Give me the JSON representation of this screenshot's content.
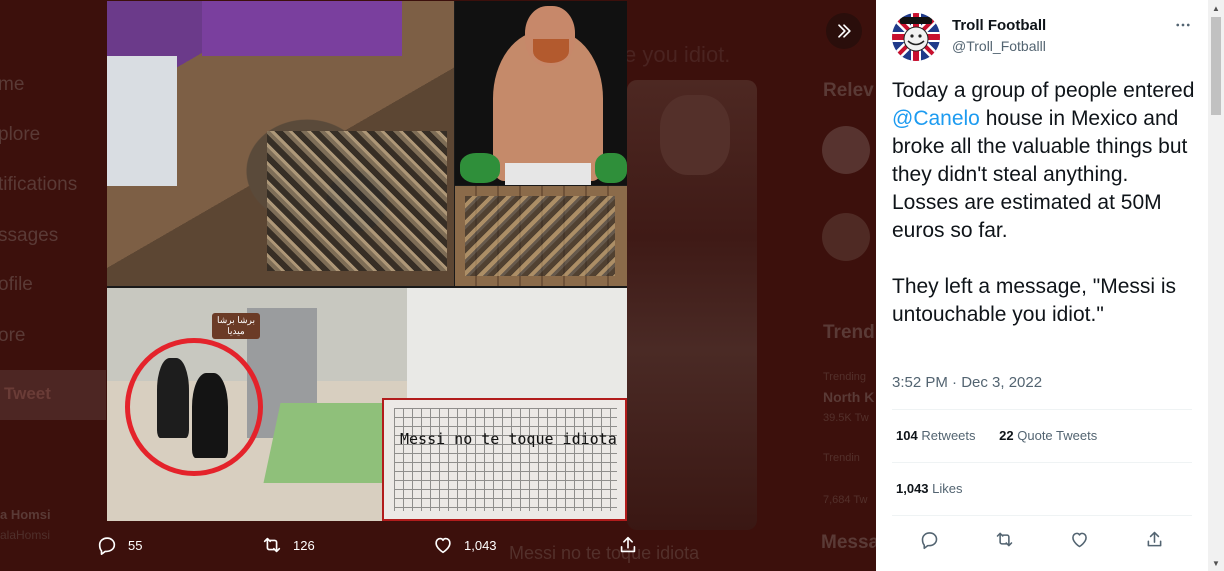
{
  "background": {
    "nav_items": [
      "me",
      "plore",
      "tifications",
      "ssages",
      "ofile",
      "ore"
    ],
    "tweet_button": "Tweet",
    "account_name": "a Homsi",
    "account_handle": "alaHomsi",
    "caption_top": "e you idiot.",
    "caption_bottom": "Messi no te toque idiota",
    "relevant_header": "Relev",
    "trends_header": "Trend",
    "trend_small_1": "Trending",
    "trend_name": "North K",
    "trend_count": "39.5K Tw",
    "trend_small_2": "Trendin",
    "trend_count_2": "7,684 Tw",
    "messages_header": "Messa"
  },
  "media": {
    "badge_line1": "برشا برشا",
    "badge_line2": "ميديا",
    "note_text": "Messi no te toque idiota"
  },
  "media_actions": {
    "replies": "55",
    "retweets": "126",
    "likes": "1,043"
  },
  "tweet": {
    "author_name": "Troll Football",
    "author_handle": "@Troll_Fotballl",
    "text_before": "Today a group of people entered ",
    "mention": "@Canelo",
    "text_after": " house in Mexico and broke all the valuable things but they didn't steal anything. Losses are estimated at 50M euros so far.\n\nThey left a message, \"Messi is untouchable you idiot.\"",
    "timestamp": "3:52 PM · Dec 3, 2022",
    "retweets_count": "104",
    "retweets_label": "Retweets",
    "quote_count": "22",
    "quote_label": "Quote Tweets",
    "likes_count": "1,043",
    "likes_label": "Likes"
  },
  "icons": {
    "expand": "chevron-double-right-icon",
    "more": "more-horizontal-icon",
    "reply": "reply-icon",
    "retweet": "retweet-icon",
    "like": "heart-icon",
    "share": "share-icon"
  },
  "colors": {
    "accent": "#1d9bf0",
    "text_primary": "#0f1419",
    "text_secondary": "#536471",
    "overlay": "#3c100c"
  }
}
